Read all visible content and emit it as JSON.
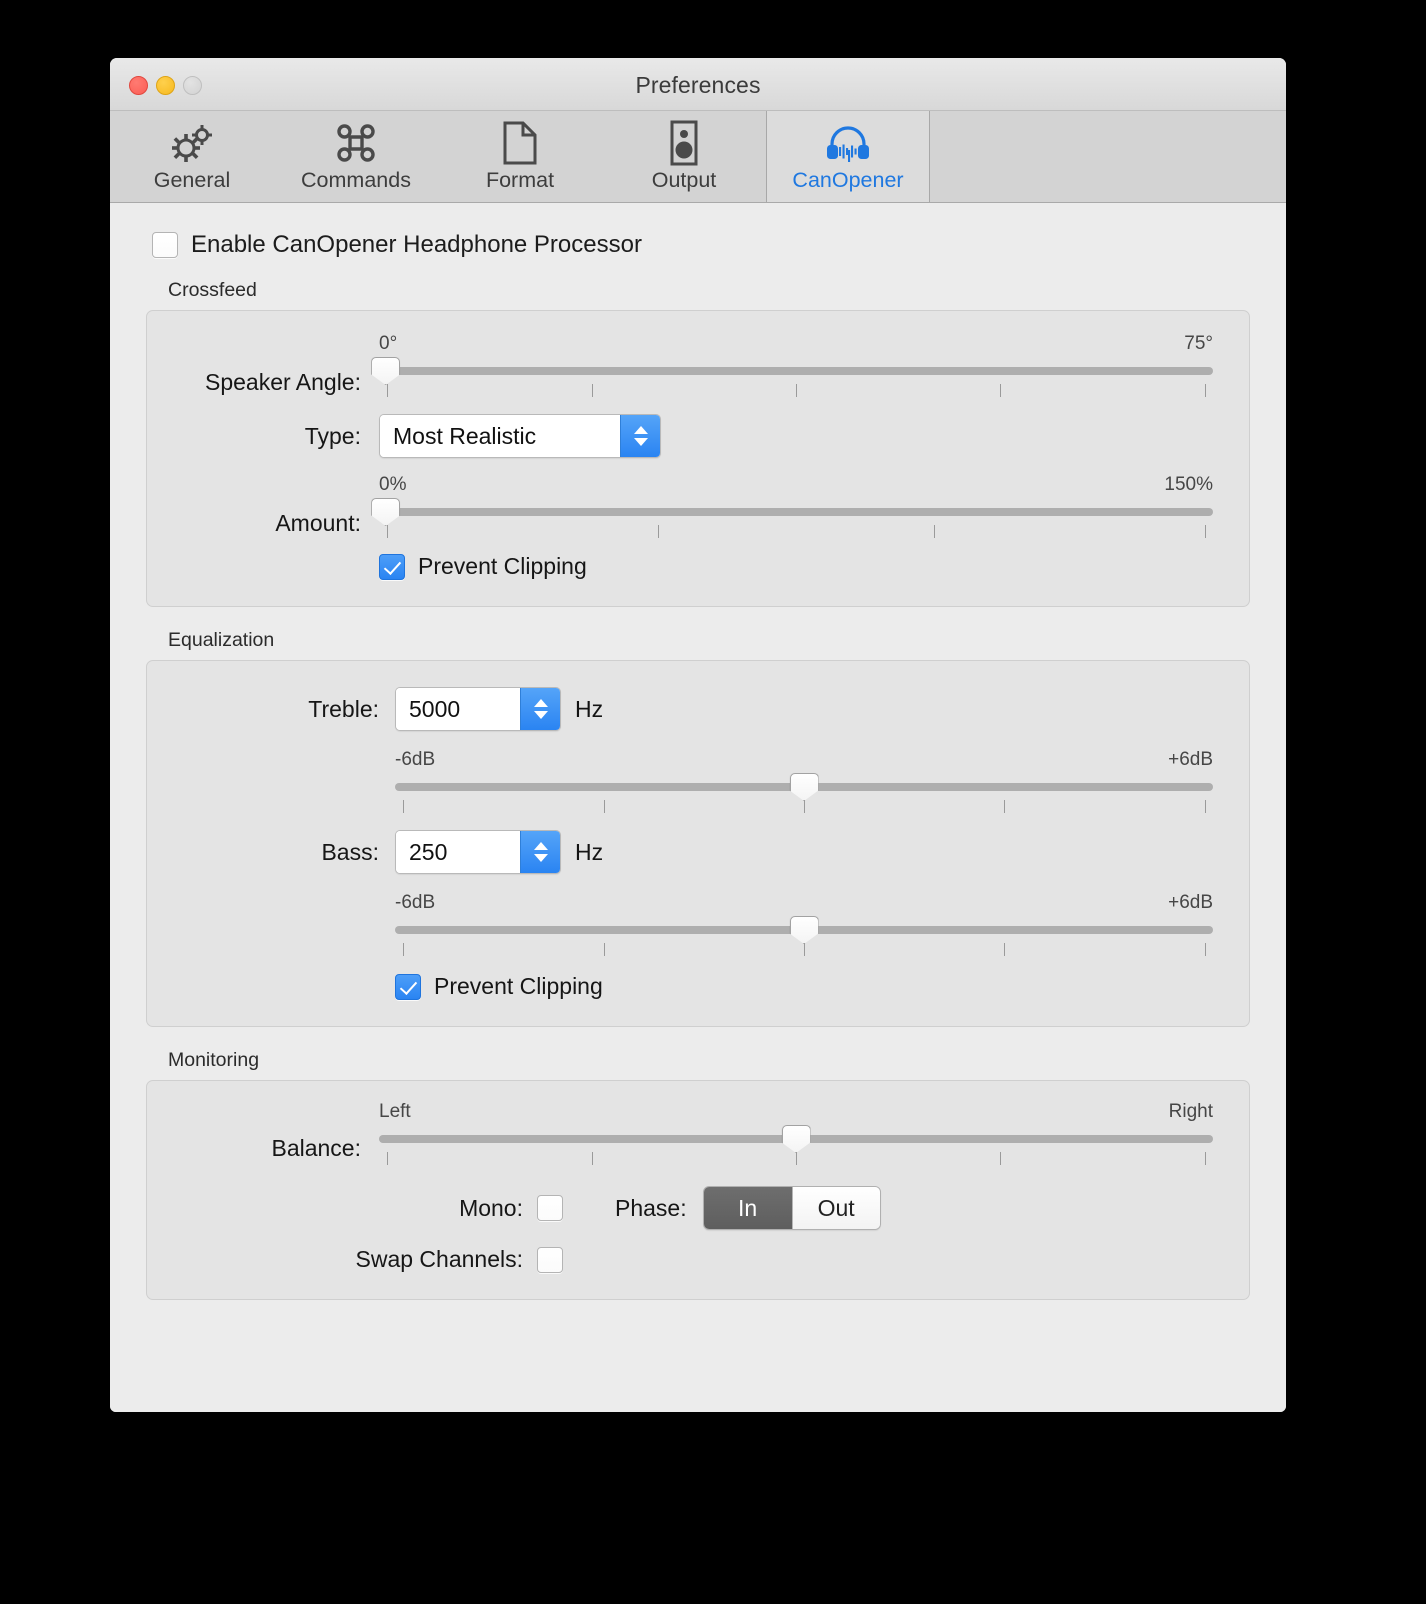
{
  "window": {
    "title": "Preferences",
    "traffic_lights": [
      "close-button",
      "minimize-button",
      "zoom-button"
    ]
  },
  "toolbar": {
    "tabs": [
      {
        "label": "General",
        "icon": "gears-icon",
        "selected": false
      },
      {
        "label": "Commands",
        "icon": "command-icon",
        "selected": false
      },
      {
        "label": "Format",
        "icon": "document-icon",
        "selected": false
      },
      {
        "label": "Output",
        "icon": "speaker-icon",
        "selected": false
      },
      {
        "label": "CanOpener",
        "icon": "headphones-icon",
        "selected": true
      }
    ],
    "selected_tab": "CanOpener",
    "accent_color": "#1f78e0"
  },
  "main": {
    "enable_checkbox": {
      "label": "Enable CanOpener Headphone Processor",
      "checked": false
    },
    "crossfeed": {
      "title": "Crossfeed",
      "speaker_angle": {
        "label": "Speaker Angle:",
        "min_label": "0°",
        "max_label": "75°",
        "value_percent": 0,
        "tick_count": 5
      },
      "type": {
        "label": "Type:",
        "value": "Most Realistic"
      },
      "amount": {
        "label": "Amount:",
        "min_label": "0%",
        "max_label": "150%",
        "value_percent": 0,
        "tick_count": 4
      },
      "prevent_clipping": {
        "label": "Prevent Clipping",
        "checked": true
      }
    },
    "equalization": {
      "title": "Equalization",
      "treble": {
        "label": "Treble:",
        "value": "5000",
        "unit": "Hz",
        "gain_min_label": "-6dB",
        "gain_max_label": "+6dB",
        "gain_percent": 50,
        "tick_count": 5
      },
      "bass": {
        "label": "Bass:",
        "value": "250",
        "unit": "Hz",
        "gain_min_label": "-6dB",
        "gain_max_label": "+6dB",
        "gain_percent": 50,
        "tick_count": 5
      },
      "prevent_clipping": {
        "label": "Prevent Clipping",
        "checked": true
      }
    },
    "monitoring": {
      "title": "Monitoring",
      "balance": {
        "label": "Balance:",
        "min_label": "Left",
        "max_label": "Right",
        "value_percent": 50,
        "tick_count": 5
      },
      "mono": {
        "label": "Mono:",
        "checked": false
      },
      "swap_channels": {
        "label": "Swap Channels:",
        "checked": false
      },
      "phase": {
        "label": "Phase:",
        "options": [
          "In",
          "Out"
        ],
        "selected": "In"
      }
    }
  },
  "colors": {
    "accent_blue": "#2a84f2",
    "window_bg": "#ececec",
    "group_bg": "#e4e4e4",
    "track": "#aeaeae"
  }
}
